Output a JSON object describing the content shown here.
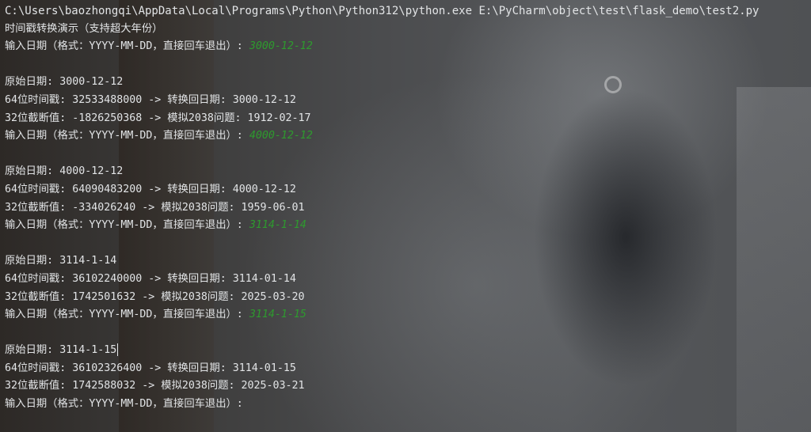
{
  "console": {
    "command": "C:\\Users\\baozhongqi\\AppData\\Local\\Programs\\Python\\Python312\\python.exe E:\\PyCharm\\object\\test\\flask_demo\\test2.py",
    "title": "时间戳转换演示（支持超大年份）",
    "prompt": "输入日期（格式：YYYY-MM-DD，直接回车退出）: ",
    "blocks": [
      {
        "input": "3000-12-12",
        "original": "原始日期: 3000-12-12",
        "ts64": "64位时间戳: 32533488000 -> 转换回日期: 3000-12-12",
        "ts32": "32位截断值: -1826250368 -> 模拟2038问题: 1912-02-17"
      },
      {
        "input": "4000-12-12",
        "original": "原始日期: 4000-12-12",
        "ts64": "64位时间戳: 64090483200 -> 转换回日期: 4000-12-12",
        "ts32": "32位截断值: -334026240 -> 模拟2038问题: 1959-06-01"
      },
      {
        "input": "3114-1-14",
        "original": "原始日期: 3114-1-14",
        "ts64": "64位时间戳: 36102240000 -> 转换回日期: 3114-01-14",
        "ts32": "32位截断值: 1742501632 -> 模拟2038问题: 2025-03-20"
      },
      {
        "input": "3114-1-15",
        "original": "原始日期: 3114-1-15",
        "ts64": "64位时间戳: 36102326400 -> 转换回日期: 3114-01-15",
        "ts32": "32位截断值: 1742588032 -> 模拟2038问题: 2025-03-21"
      }
    ],
    "colors": {
      "text": "#e2e4e6",
      "user_input": "#2e9a2e"
    }
  }
}
